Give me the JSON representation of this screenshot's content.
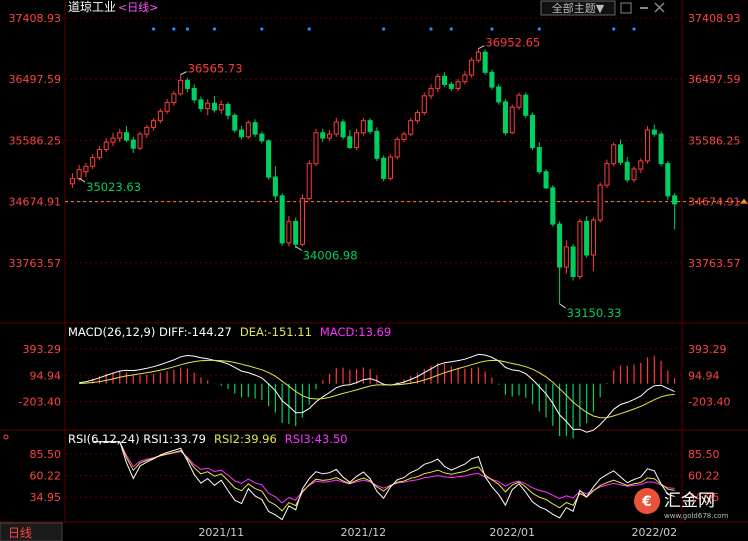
{
  "window": {
    "title": "道琼工业",
    "period": "<日线>",
    "theme_button": "全部主题▼",
    "bottom_tab": "日线"
  },
  "watermark": {
    "logo_text": "汇金网",
    "url": "www.gold678.com"
  },
  "colors": {
    "up": "#ff3b3b",
    "down": "#00d060",
    "diff_line": "#ffffff",
    "dea_line": "#e6e64a",
    "macd_bar_label": "#ff33ff",
    "rsi1": "#ffffff",
    "rsi2": "#e6e64a",
    "rsi3": "#ff33ff",
    "grid": "#5a0000",
    "axis_text": "#ff4444",
    "price_line": "#ff8c1a",
    "marker": "#1e90ff"
  },
  "chart_data": [
    {
      "type": "candlestick",
      "title": "道琼工业",
      "y_ticks": [
        "37408.93",
        "36497.59",
        "35586.25",
        "34674.91",
        "33763.57"
      ],
      "ylim": [
        33150,
        37408.93
      ],
      "x_ticks": [
        "2021/11",
        "2021/12",
        "2022/01",
        "2022/02"
      ],
      "current_price_label": "34674.91",
      "annotations": [
        {
          "label": "36565.73",
          "type": "high"
        },
        {
          "label": "35023.63",
          "type": "low"
        },
        {
          "label": "34006.98",
          "type": "low"
        },
        {
          "label": "36952.65",
          "type": "high"
        },
        {
          "label": "33150.33",
          "type": "low"
        }
      ],
      "candles": [
        [
          34940,
          35100,
          34880,
          35020
        ],
        [
          35020,
          35220,
          34980,
          35150
        ],
        [
          35120,
          35250,
          35040,
          35200
        ],
        [
          35200,
          35380,
          35160,
          35330
        ],
        [
          35330,
          35500,
          35290,
          35450
        ],
        [
          35450,
          35620,
          35410,
          35560
        ],
        [
          35560,
          35700,
          35500,
          35620
        ],
        [
          35620,
          35760,
          35560,
          35700
        ],
        [
          35700,
          35800,
          35560,
          35590
        ],
        [
          35590,
          35640,
          35400,
          35470
        ],
        [
          35470,
          35720,
          35440,
          35680
        ],
        [
          35680,
          35820,
          35620,
          35780
        ],
        [
          35780,
          35920,
          35730,
          35880
        ],
        [
          35880,
          36060,
          35840,
          36020
        ],
        [
          36020,
          36200,
          35980,
          36150
        ],
        [
          36150,
          36320,
          36100,
          36280
        ],
        [
          36280,
          36566,
          36250,
          36480
        ],
        [
          36480,
          36520,
          36300,
          36360
        ],
        [
          36360,
          36420,
          36140,
          36190
        ],
        [
          36190,
          36240,
          36010,
          36060
        ],
        [
          36060,
          36200,
          35960,
          36140
        ],
        [
          36140,
          36250,
          36000,
          36040
        ],
        [
          36040,
          36180,
          35980,
          36120
        ],
        [
          36120,
          36160,
          35900,
          35960
        ],
        [
          35960,
          35990,
          35700,
          35740
        ],
        [
          35740,
          35800,
          35600,
          35640
        ],
        [
          35640,
          35880,
          35610,
          35850
        ],
        [
          35850,
          35900,
          35640,
          35680
        ],
        [
          35680,
          35720,
          35540,
          35580
        ],
        [
          35580,
          35600,
          35000,
          35040
        ],
        [
          35040,
          35200,
          34700,
          34760
        ],
        [
          34760,
          34800,
          34020,
          34060
        ],
        [
          34060,
          34460,
          34007,
          34380
        ],
        [
          34380,
          34440,
          33980,
          34040
        ],
        [
          34040,
          34780,
          34010,
          34720
        ],
        [
          34720,
          35290,
          34690,
          35240
        ],
        [
          35240,
          35760,
          35200,
          35700
        ],
        [
          35700,
          35760,
          35560,
          35620
        ],
        [
          35620,
          35740,
          35580,
          35680
        ],
        [
          35680,
          35920,
          35640,
          35860
        ],
        [
          35860,
          35900,
          35600,
          35640
        ],
        [
          35640,
          35740,
          35460,
          35480
        ],
        [
          35480,
          35760,
          35440,
          35700
        ],
        [
          35700,
          35920,
          35660,
          35880
        ],
        [
          35880,
          35920,
          35680,
          35720
        ],
        [
          35720,
          35780,
          35280,
          35320
        ],
        [
          35320,
          35360,
          34980,
          35020
        ],
        [
          35020,
          35380,
          34990,
          35340
        ],
        [
          35340,
          35640,
          35300,
          35600
        ],
        [
          35600,
          35720,
          35560,
          35680
        ],
        [
          35680,
          35920,
          35650,
          35880
        ],
        [
          35880,
          36040,
          35840,
          36000
        ],
        [
          36000,
          36300,
          35960,
          36250
        ],
        [
          36250,
          36420,
          36200,
          36360
        ],
        [
          36360,
          36580,
          36300,
          36540
        ],
        [
          36540,
          36600,
          36380,
          36420
        ],
        [
          36420,
          36460,
          36320,
          36360
        ],
        [
          36360,
          36500,
          36320,
          36460
        ],
        [
          36460,
          36620,
          36420,
          36560
        ],
        [
          36560,
          36820,
          36520,
          36780
        ],
        [
          36780,
          36953,
          36740,
          36900
        ],
        [
          36900,
          36940,
          36560,
          36600
        ],
        [
          36600,
          36640,
          36340,
          36380
        ],
        [
          36380,
          36420,
          36120,
          36160
        ],
        [
          36160,
          36200,
          35660,
          35700
        ],
        [
          35700,
          36120,
          35680,
          36080
        ],
        [
          36080,
          36300,
          36040,
          36260
        ],
        [
          36260,
          36300,
          35920,
          35960
        ],
        [
          35960,
          36000,
          35440,
          35480
        ],
        [
          35480,
          35560,
          35080,
          35120
        ],
        [
          35120,
          35160,
          34860,
          34880
        ],
        [
          34880,
          34920,
          34300,
          34340
        ],
        [
          34340,
          34380,
          33150,
          33700
        ],
        [
          33700,
          34100,
          33600,
          34000
        ],
        [
          34000,
          34040,
          33500,
          33560
        ],
        [
          33560,
          34420,
          33520,
          34380
        ],
        [
          34380,
          34460,
          33840,
          33880
        ],
        [
          33880,
          34440,
          33640,
          34400
        ],
        [
          34400,
          34960,
          34360,
          34920
        ],
        [
          34920,
          35300,
          34880,
          35240
        ],
        [
          35240,
          35560,
          35200,
          35520
        ],
        [
          35520,
          35600,
          35220,
          35260
        ],
        [
          35260,
          35340,
          34960,
          35000
        ],
        [
          35000,
          35200,
          34960,
          35160
        ],
        [
          35160,
          35320,
          35100,
          35280
        ],
        [
          35280,
          35800,
          35240,
          35740
        ],
        [
          35740,
          35820,
          35640,
          35680
        ],
        [
          35680,
          35720,
          35200,
          35240
        ],
        [
          35240,
          35280,
          34700,
          34760
        ],
        [
          34760,
          34800,
          34260,
          34640
        ]
      ]
    },
    {
      "type": "macd",
      "params": "MACD(26,12,9)",
      "diff_label": "DIFF:-144.27",
      "dea_label": "DEA:-151.11",
      "macd_label": "MACD:13.69",
      "y_ticks": [
        "393.29",
        "94.94",
        "-203.40"
      ],
      "ylim": [
        -320,
        460
      ]
    },
    {
      "type": "rsi",
      "params": "RSI(6,12,24)",
      "rsi1_label": "RSI1:33.79",
      "rsi2_label": "RSI2:39.96",
      "rsi3_label": "RSI3:43.50",
      "y_ticks": [
        "85.50",
        "60.22",
        "34.95"
      ],
      "ylim": [
        20,
        95
      ]
    }
  ]
}
